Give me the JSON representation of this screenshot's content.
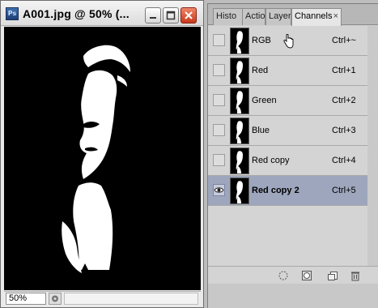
{
  "document": {
    "title": "A001.jpg @ 50% (...",
    "app_icon": "photoshop-icon",
    "zoom": "50%"
  },
  "panel": {
    "tabs": [
      {
        "label": "Histo"
      },
      {
        "label": "Actio"
      },
      {
        "label": "Layer"
      },
      {
        "label": "Channels",
        "close": "×"
      }
    ],
    "channels": [
      {
        "name": "RGB",
        "shortcut": "Ctrl+~",
        "visible": false,
        "selected": false
      },
      {
        "name": "Red",
        "shortcut": "Ctrl+1",
        "visible": false,
        "selected": false
      },
      {
        "name": "Green",
        "shortcut": "Ctrl+2",
        "visible": false,
        "selected": false
      },
      {
        "name": "Blue",
        "shortcut": "Ctrl+3",
        "visible": false,
        "selected": false
      },
      {
        "name": "Red copy",
        "shortcut": "Ctrl+4",
        "visible": false,
        "selected": false
      },
      {
        "name": "Red copy 2",
        "shortcut": "Ctrl+5",
        "visible": true,
        "selected": true
      }
    ],
    "footer_icons": [
      "load-selection-icon",
      "save-selection-icon",
      "new-channel-icon",
      "delete-channel-icon"
    ]
  },
  "colors": {
    "selected_row": "#9da6bc",
    "close_button": "#d64a2a"
  }
}
